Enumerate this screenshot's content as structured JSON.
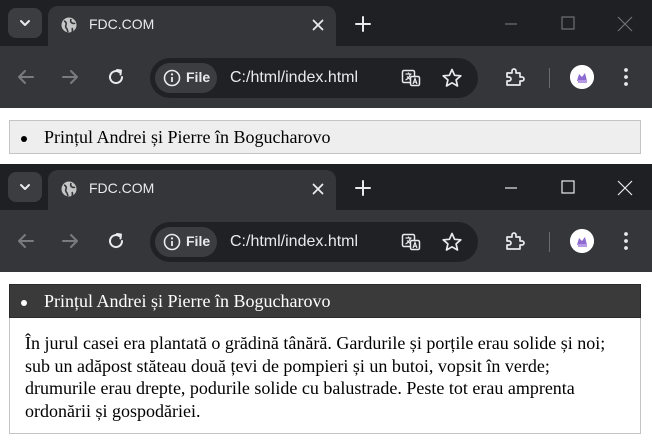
{
  "windows": [
    {
      "tab": {
        "title": "FDC.COM"
      },
      "toolbar": {
        "chip_label": "File",
        "url": "C:/html/index.html"
      },
      "page": {
        "list_item": "Prințul Andrei și Pierre în Bogucharovo"
      }
    },
    {
      "tab": {
        "title": "FDC.COM"
      },
      "toolbar": {
        "chip_label": "File",
        "url": "C:/html/index.html"
      },
      "page": {
        "list_item": "Prințul Andrei și Pierre în Bogucharovo",
        "description": "În jurul casei era plantată o grădină tânără. Gardurile și porțile erau solide și noi; sub un adăpost stăteau două țevi de pompieri și un butoi, vopsit în verde; drumurile erau drepte, podurile solide cu balustrade. Peste tot erau amprenta ordonării și gospodăriei."
      }
    }
  ],
  "colors": {
    "tabstrip": "#1f2024",
    "toolbar": "#35363a",
    "omnibox": "#202124",
    "icon": "#c4c7c5",
    "active_item_bg": "#3a3a3a",
    "item_bg": "#eeeeee"
  },
  "icons": [
    "tab-search-icon",
    "globe-icon",
    "close-icon",
    "plus-icon",
    "minimize-icon",
    "maximize-icon",
    "back-arrow-icon",
    "forward-arrow-icon",
    "reload-icon",
    "info-icon",
    "translate-icon",
    "star-icon",
    "extensions-icon",
    "avatar",
    "kebab-menu-icon"
  ]
}
